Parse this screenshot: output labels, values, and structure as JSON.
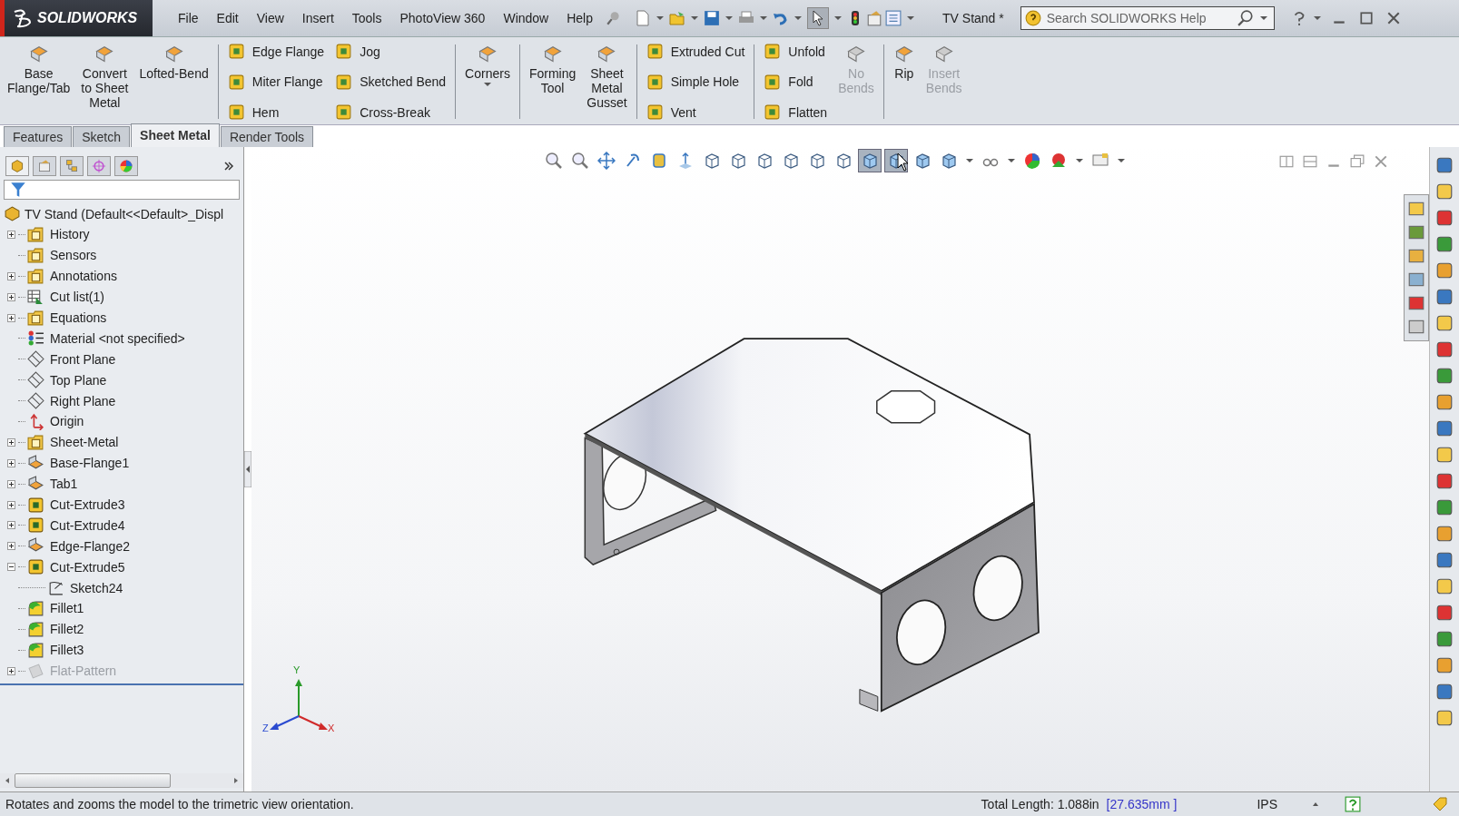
{
  "title_bar": {
    "logo": "SOLIDWORKS",
    "menus": [
      "File",
      "Edit",
      "View",
      "Insert",
      "Tools",
      "PhotoView 360",
      "Window",
      "Help"
    ],
    "document_title": "TV Stand *",
    "search": {
      "placeholder": "Search SOLIDWORKS Help"
    }
  },
  "ribbon": {
    "groups": [
      {
        "columns": [
          {
            "kind": "large",
            "items": [
              {
                "label": "Base\nFlange/Tab",
                "disabled": false,
                "dropdown": false
              }
            ]
          },
          {
            "kind": "large",
            "items": [
              {
                "label": "Convert\nto Sheet\nMetal",
                "disabled": false,
                "dropdown": false
              }
            ]
          },
          {
            "kind": "large",
            "items": [
              {
                "label": "Lofted-Bend",
                "disabled": false,
                "dropdown": false
              }
            ]
          }
        ]
      },
      {
        "columns": [
          {
            "kind": "stack",
            "items": [
              {
                "label": "Edge Flange",
                "disabled": false
              },
              {
                "label": "Miter Flange",
                "disabled": false
              },
              {
                "label": "Hem",
                "disabled": false
              }
            ]
          },
          {
            "kind": "stack",
            "items": [
              {
                "label": "Jog",
                "disabled": false
              },
              {
                "label": "Sketched Bend",
                "disabled": false
              },
              {
                "label": "Cross-Break",
                "disabled": false
              }
            ]
          }
        ]
      },
      {
        "columns": [
          {
            "kind": "large",
            "items": [
              {
                "label": "Corners",
                "disabled": false,
                "dropdown": true
              }
            ]
          }
        ]
      },
      {
        "columns": [
          {
            "kind": "large",
            "items": [
              {
                "label": "Forming\nTool",
                "disabled": false,
                "dropdown": false
              }
            ]
          },
          {
            "kind": "large",
            "items": [
              {
                "label": "Sheet\nMetal\nGusset",
                "disabled": false,
                "dropdown": false
              }
            ]
          }
        ]
      },
      {
        "columns": [
          {
            "kind": "stack",
            "items": [
              {
                "label": "Extruded Cut",
                "disabled": false
              },
              {
                "label": "Simple Hole",
                "disabled": false
              },
              {
                "label": "Vent",
                "disabled": false
              }
            ]
          }
        ]
      },
      {
        "columns": [
          {
            "kind": "stack",
            "items": [
              {
                "label": "Unfold",
                "disabled": false
              },
              {
                "label": "Fold",
                "disabled": false
              },
              {
                "label": "Flatten",
                "disabled": false
              }
            ]
          },
          {
            "kind": "large",
            "items": [
              {
                "label": "No\nBends",
                "disabled": true,
                "dropdown": false
              }
            ]
          }
        ]
      },
      {
        "columns": [
          {
            "kind": "large",
            "items": [
              {
                "label": "Rip",
                "disabled": false,
                "dropdown": false
              }
            ]
          },
          {
            "kind": "large",
            "items": [
              {
                "label": "Insert\nBends",
                "disabled": true,
                "dropdown": false
              }
            ]
          }
        ]
      }
    ]
  },
  "command_tabs": [
    {
      "label": "Features",
      "selected": false
    },
    {
      "label": "Sketch",
      "selected": false
    },
    {
      "label": "Sheet Metal",
      "selected": true
    },
    {
      "label": "Render Tools",
      "selected": false
    }
  ],
  "feature_tree": {
    "root": "TV Stand  (Default<<Default>_Displ",
    "items": [
      {
        "label": "History",
        "kind": "folder",
        "expanded": false,
        "disabled": false
      },
      {
        "label": "Sensors",
        "kind": "folder",
        "disabled": false
      },
      {
        "label": "Annotations",
        "kind": "folder",
        "expanded": false,
        "disabled": false
      },
      {
        "label": "Cut list(1)",
        "kind": "cutlist",
        "expanded": false,
        "disabled": false
      },
      {
        "label": "Equations",
        "kind": "folder",
        "expanded": false,
        "disabled": false
      },
      {
        "label": "Material <not specified>",
        "kind": "material",
        "disabled": false
      },
      {
        "label": "Front Plane",
        "kind": "plane",
        "disabled": false
      },
      {
        "label": "Top Plane",
        "kind": "plane",
        "disabled": false
      },
      {
        "label": "Right Plane",
        "kind": "plane",
        "disabled": false
      },
      {
        "label": "Origin",
        "kind": "origin",
        "disabled": false
      },
      {
        "label": "Sheet-Metal",
        "kind": "folder",
        "expanded": false,
        "disabled": false
      },
      {
        "label": "Base-Flange1",
        "kind": "flange",
        "expanded": false,
        "disabled": false
      },
      {
        "label": "Tab1",
        "kind": "flange",
        "expanded": false,
        "disabled": false
      },
      {
        "label": "Cut-Extrude3",
        "kind": "cut",
        "expanded": false,
        "disabled": false
      },
      {
        "label": "Cut-Extrude4",
        "kind": "cut",
        "expanded": false,
        "disabled": false
      },
      {
        "label": "Edge-Flange2",
        "kind": "flange",
        "expanded": false,
        "disabled": false
      },
      {
        "label": "Cut-Extrude5",
        "kind": "cut",
        "expanded": true,
        "disabled": false,
        "children": [
          {
            "label": "Sketch24",
            "kind": "sketch",
            "disabled": false
          }
        ]
      },
      {
        "label": "Fillet1",
        "kind": "fillet",
        "disabled": false
      },
      {
        "label": "Fillet2",
        "kind": "fillet",
        "disabled": false
      },
      {
        "label": "Fillet3",
        "kind": "fillet",
        "disabled": false
      },
      {
        "label": "Flat-Pattern",
        "kind": "flat",
        "expanded": false,
        "disabled": true
      }
    ]
  },
  "view_toolbar": [
    {
      "selected": false
    },
    {
      "selected": false
    },
    {
      "selected": false
    },
    {
      "selected": false
    },
    {
      "selected": false
    },
    {
      "selected": false
    },
    {
      "selected": false
    },
    {
      "selected": false
    },
    {
      "selected": false
    },
    {
      "selected": false
    },
    {
      "selected": false
    },
    {
      "selected": false
    },
    {
      "selected": true
    },
    {
      "selected": true
    },
    {
      "selected": false
    },
    {
      "selected": false
    },
    {
      "selected": false
    },
    {
      "selected": false
    },
    {
      "selected": false
    },
    {
      "selected": false
    }
  ],
  "triad": {
    "y": "Y",
    "z": "Z",
    "x": "X"
  },
  "status_bar": {
    "message": "Rotates and zooms the model to the trimetric view orientation.",
    "total_length": "Total Length: 1.088in",
    "metric_length": "[27.635mm ]",
    "units": "IPS"
  }
}
